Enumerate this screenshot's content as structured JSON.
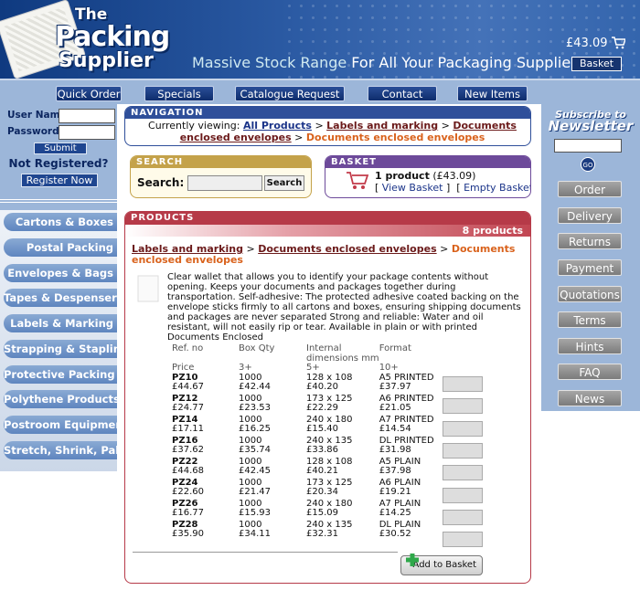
{
  "header": {
    "logo": {
      "line1": "The",
      "line2": "Packing",
      "line3": "Supplier"
    },
    "tagline_prefix": "Massive Stock Range",
    "tagline_suffix": "For All Your Packaging Supplies",
    "basket_total": "£43.09",
    "basket_button": "Basket"
  },
  "nav": [
    "Quick Order",
    "Specials",
    "Catalogue Request",
    "Contact",
    "New Items"
  ],
  "login": {
    "username_label": "User Name",
    "password_label": "Password",
    "submit": "Submit",
    "not_registered": "Not Registered?",
    "register": "Register Now"
  },
  "categories": [
    "Cartons & Boxes",
    "Postal Packing",
    "Envelopes & Bags",
    "Tapes & Despensers",
    "Labels & Marking",
    "Strapping & Stapling",
    "Protective Packing",
    "Polythene Products",
    "Postroom Equipment",
    "Stretch, Shrink, Pallet"
  ],
  "newsletter": {
    "subscribe": "Subscribe to",
    "title": "Newsletter",
    "go": "GO"
  },
  "right_nav": [
    "Order",
    "Delivery",
    "Returns",
    "Payment",
    "Quotations",
    "Terms",
    "Hints",
    "FAQ",
    "News"
  ],
  "navigation_panel": {
    "title": "NAVIGATION",
    "viewing": "Currently viewing:",
    "all_products": "All Products",
    "sep": ">",
    "labels_marking": "Labels and marking",
    "doc_env": "Documents enclosed envelopes",
    "current": "Documents enclosed envelopes"
  },
  "search_panel": {
    "title": "SEARCH",
    "label": "Search:",
    "button": "Search"
  },
  "basket_panel": {
    "title": "BASKET",
    "count": "1 product",
    "total": "(£43.09)",
    "view": "View Basket",
    "empty": "Empty Basket"
  },
  "products_panel": {
    "title": "PRODUCTS",
    "count": "8 products",
    "crumb1": "Labels and marking",
    "crumb2": "Documents enclosed envelopes",
    "crumb_current": "Documents enclosed envelopes",
    "description": "Clear wallet that allows you to identify your package contents without opening. Keeps your documents and packages together during transportation. Self-adhesive: The protected adhesive coated backing on the envelope sticks firmly to all cartons and boxes, ensuring shipping documents and packages are never separated Strong and reliable: Water and oil resistant, will not easily rip or tear. Available in plain or with printed Documents Enclosed",
    "headers": {
      "ref": "Ref. no",
      "box_qty": "Box Qty",
      "internal": "Internal",
      "dimensions": "dimensions mm",
      "format": "Format",
      "price": "Price",
      "q3": "3+",
      "q5": "5+",
      "q10": "10+"
    },
    "rows": [
      {
        "ref": "PZ10",
        "qty": "1000",
        "dim": "128 x 108",
        "format": "A5 PRINTED",
        "price": "£44.67",
        "p3": "£42.44",
        "p5": "£40.20",
        "p10": "£37.97"
      },
      {
        "ref": "PZ12",
        "qty": "1000",
        "dim": "173 x 125",
        "format": "A6 PRINTED",
        "price": "£24.77",
        "p3": "£23.53",
        "p5": "£22.29",
        "p10": "£21.05"
      },
      {
        "ref": "PZ14",
        "qty": "1000",
        "dim": "240 x 180",
        "format": "A7 PRINTED",
        "price": "£17.11",
        "p3": "£16.25",
        "p5": "£15.40",
        "p10": "£14.54"
      },
      {
        "ref": "PZ16",
        "qty": "1000",
        "dim": "240 x 135",
        "format": "DL PRINTED",
        "price": "£37.62",
        "p3": "£35.74",
        "p5": "£33.86",
        "p10": "£31.98"
      },
      {
        "ref": "PZ22",
        "qty": "1000",
        "dim": "128 x 108",
        "format": "A5 PLAIN",
        "price": "£44.68",
        "p3": "£42.45",
        "p5": "£40.21",
        "p10": "£37.98"
      },
      {
        "ref": "PZ24",
        "qty": "1000",
        "dim": "173 x 125",
        "format": "A6 PLAIN",
        "price": "£22.60",
        "p3": "£21.47",
        "p5": "£20.34",
        "p10": "£19.21"
      },
      {
        "ref": "PZ26",
        "qty": "1000",
        "dim": "240 x 180",
        "format": "A7 PLAIN",
        "price": "£16.77",
        "p3": "£15.93",
        "p5": "£15.09",
        "p10": "£14.25"
      },
      {
        "ref": "PZ28",
        "qty": "1000",
        "dim": "240 x 135",
        "format": "DL PLAIN",
        "price": "£35.90",
        "p3": "£34.11",
        "p5": "£32.31",
        "p10": "£30.52"
      }
    ],
    "add_to_basket": "Add to Basket"
  }
}
